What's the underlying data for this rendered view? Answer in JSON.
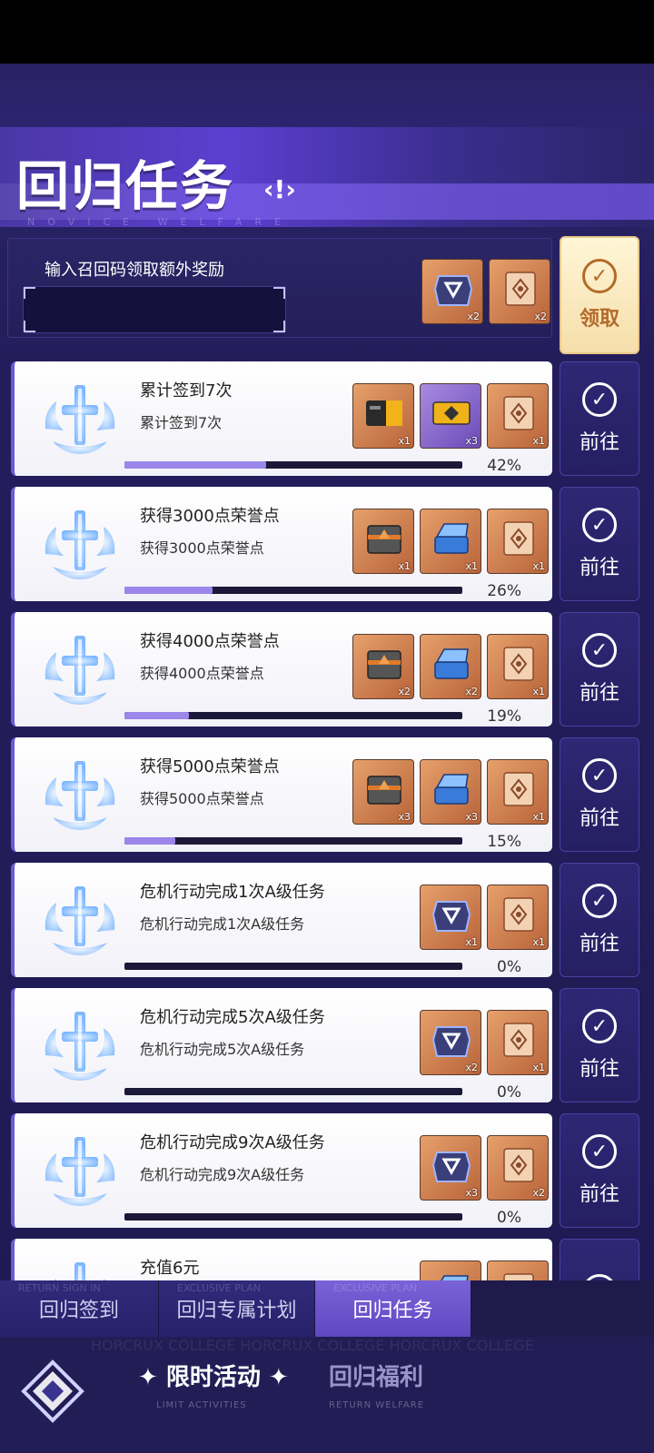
{
  "header": {
    "title": "回归任务",
    "title_mark": "‹!›",
    "subtitle": "NOVICE WELFARE"
  },
  "invite": {
    "label": "输入召回码领取额外奖励",
    "input_value": "",
    "rewards": [
      {
        "icon": "crisis-emblem",
        "qty": "x2"
      },
      {
        "icon": "scroll-ticket",
        "qty": "x2"
      }
    ],
    "claim_label": "领取"
  },
  "tasks": [
    {
      "title": "累计签到7次",
      "sub": "累计签到7次",
      "progress": 0.42,
      "pct": "42%",
      "rewards": [
        {
          "icon": "card-black",
          "qty": "x1"
        },
        {
          "icon": "card-gold",
          "qty": "x3"
        },
        {
          "icon": "scroll-ticket",
          "qty": "x1"
        }
      ],
      "btn": "前往"
    },
    {
      "title": "获得3000点荣誉点",
      "sub": "获得3000点荣誉点",
      "progress": 0.26,
      "pct": "26%",
      "rewards": [
        {
          "icon": "supply-crate",
          "qty": "x1"
        },
        {
          "icon": "blue-case",
          "qty": "x1"
        },
        {
          "icon": "scroll-ticket",
          "qty": "x1"
        }
      ],
      "btn": "前往"
    },
    {
      "title": "获得4000点荣誉点",
      "sub": "获得4000点荣誉点",
      "progress": 0.19,
      "pct": "19%",
      "rewards": [
        {
          "icon": "supply-crate",
          "qty": "x2"
        },
        {
          "icon": "blue-case",
          "qty": "x2"
        },
        {
          "icon": "scroll-ticket",
          "qty": "x1"
        }
      ],
      "btn": "前往"
    },
    {
      "title": "获得5000点荣誉点",
      "sub": "获得5000点荣誉点",
      "progress": 0.15,
      "pct": "15%",
      "rewards": [
        {
          "icon": "supply-crate",
          "qty": "x3"
        },
        {
          "icon": "blue-case",
          "qty": "x3"
        },
        {
          "icon": "scroll-ticket",
          "qty": "x1"
        }
      ],
      "btn": "前往"
    },
    {
      "title": "危机行动完成1次A级任务",
      "sub": "危机行动完成1次A级任务",
      "progress": 0,
      "pct": "0%",
      "rewards": [
        {
          "icon": "crisis-emblem",
          "qty": "x1"
        },
        {
          "icon": "scroll-ticket",
          "qty": "x1"
        }
      ],
      "btn": "前往"
    },
    {
      "title": "危机行动完成5次A级任务",
      "sub": "危机行动完成5次A级任务",
      "progress": 0,
      "pct": "0%",
      "rewards": [
        {
          "icon": "crisis-emblem",
          "qty": "x2"
        },
        {
          "icon": "scroll-ticket",
          "qty": "x1"
        }
      ],
      "btn": "前往"
    },
    {
      "title": "危机行动完成9次A级任务",
      "sub": "危机行动完成9次A级任务",
      "progress": 0,
      "pct": "0%",
      "rewards": [
        {
          "icon": "crisis-emblem",
          "qty": "x3"
        },
        {
          "icon": "scroll-ticket",
          "qty": "x2"
        }
      ],
      "btn": "前往"
    },
    {
      "title": "充值6元",
      "sub": "",
      "progress": 0,
      "pct": "",
      "rewards": [
        {
          "icon": "blue-case",
          "qty": ""
        },
        {
          "icon": "scroll-ticket",
          "qty": ""
        }
      ],
      "btn": ""
    }
  ],
  "tabs": [
    {
      "label": "回归签到",
      "ghost": "RETURN SIGN IN",
      "active": false
    },
    {
      "label": "回归专属计划",
      "ghost": "EXCLUSIVE PLAN",
      "active": false
    },
    {
      "label": "回归任务",
      "ghost": "EXCLUSIVE PLAN",
      "active": true
    }
  ],
  "footer": {
    "ghost": "HORCRUX COLLEGE  HORCRUX COLLEGE  HORCRUX COLLEGE",
    "tab_active": "✦ 限时活动 ✦",
    "tab_active_sub": "LIMIT ACTIVITIES",
    "tab_other": "回归福利",
    "tab_other_sub": "RETURN WELFARE"
  },
  "colors": {
    "accent": "#9b86ea",
    "claim_text": "#b36a2a"
  }
}
